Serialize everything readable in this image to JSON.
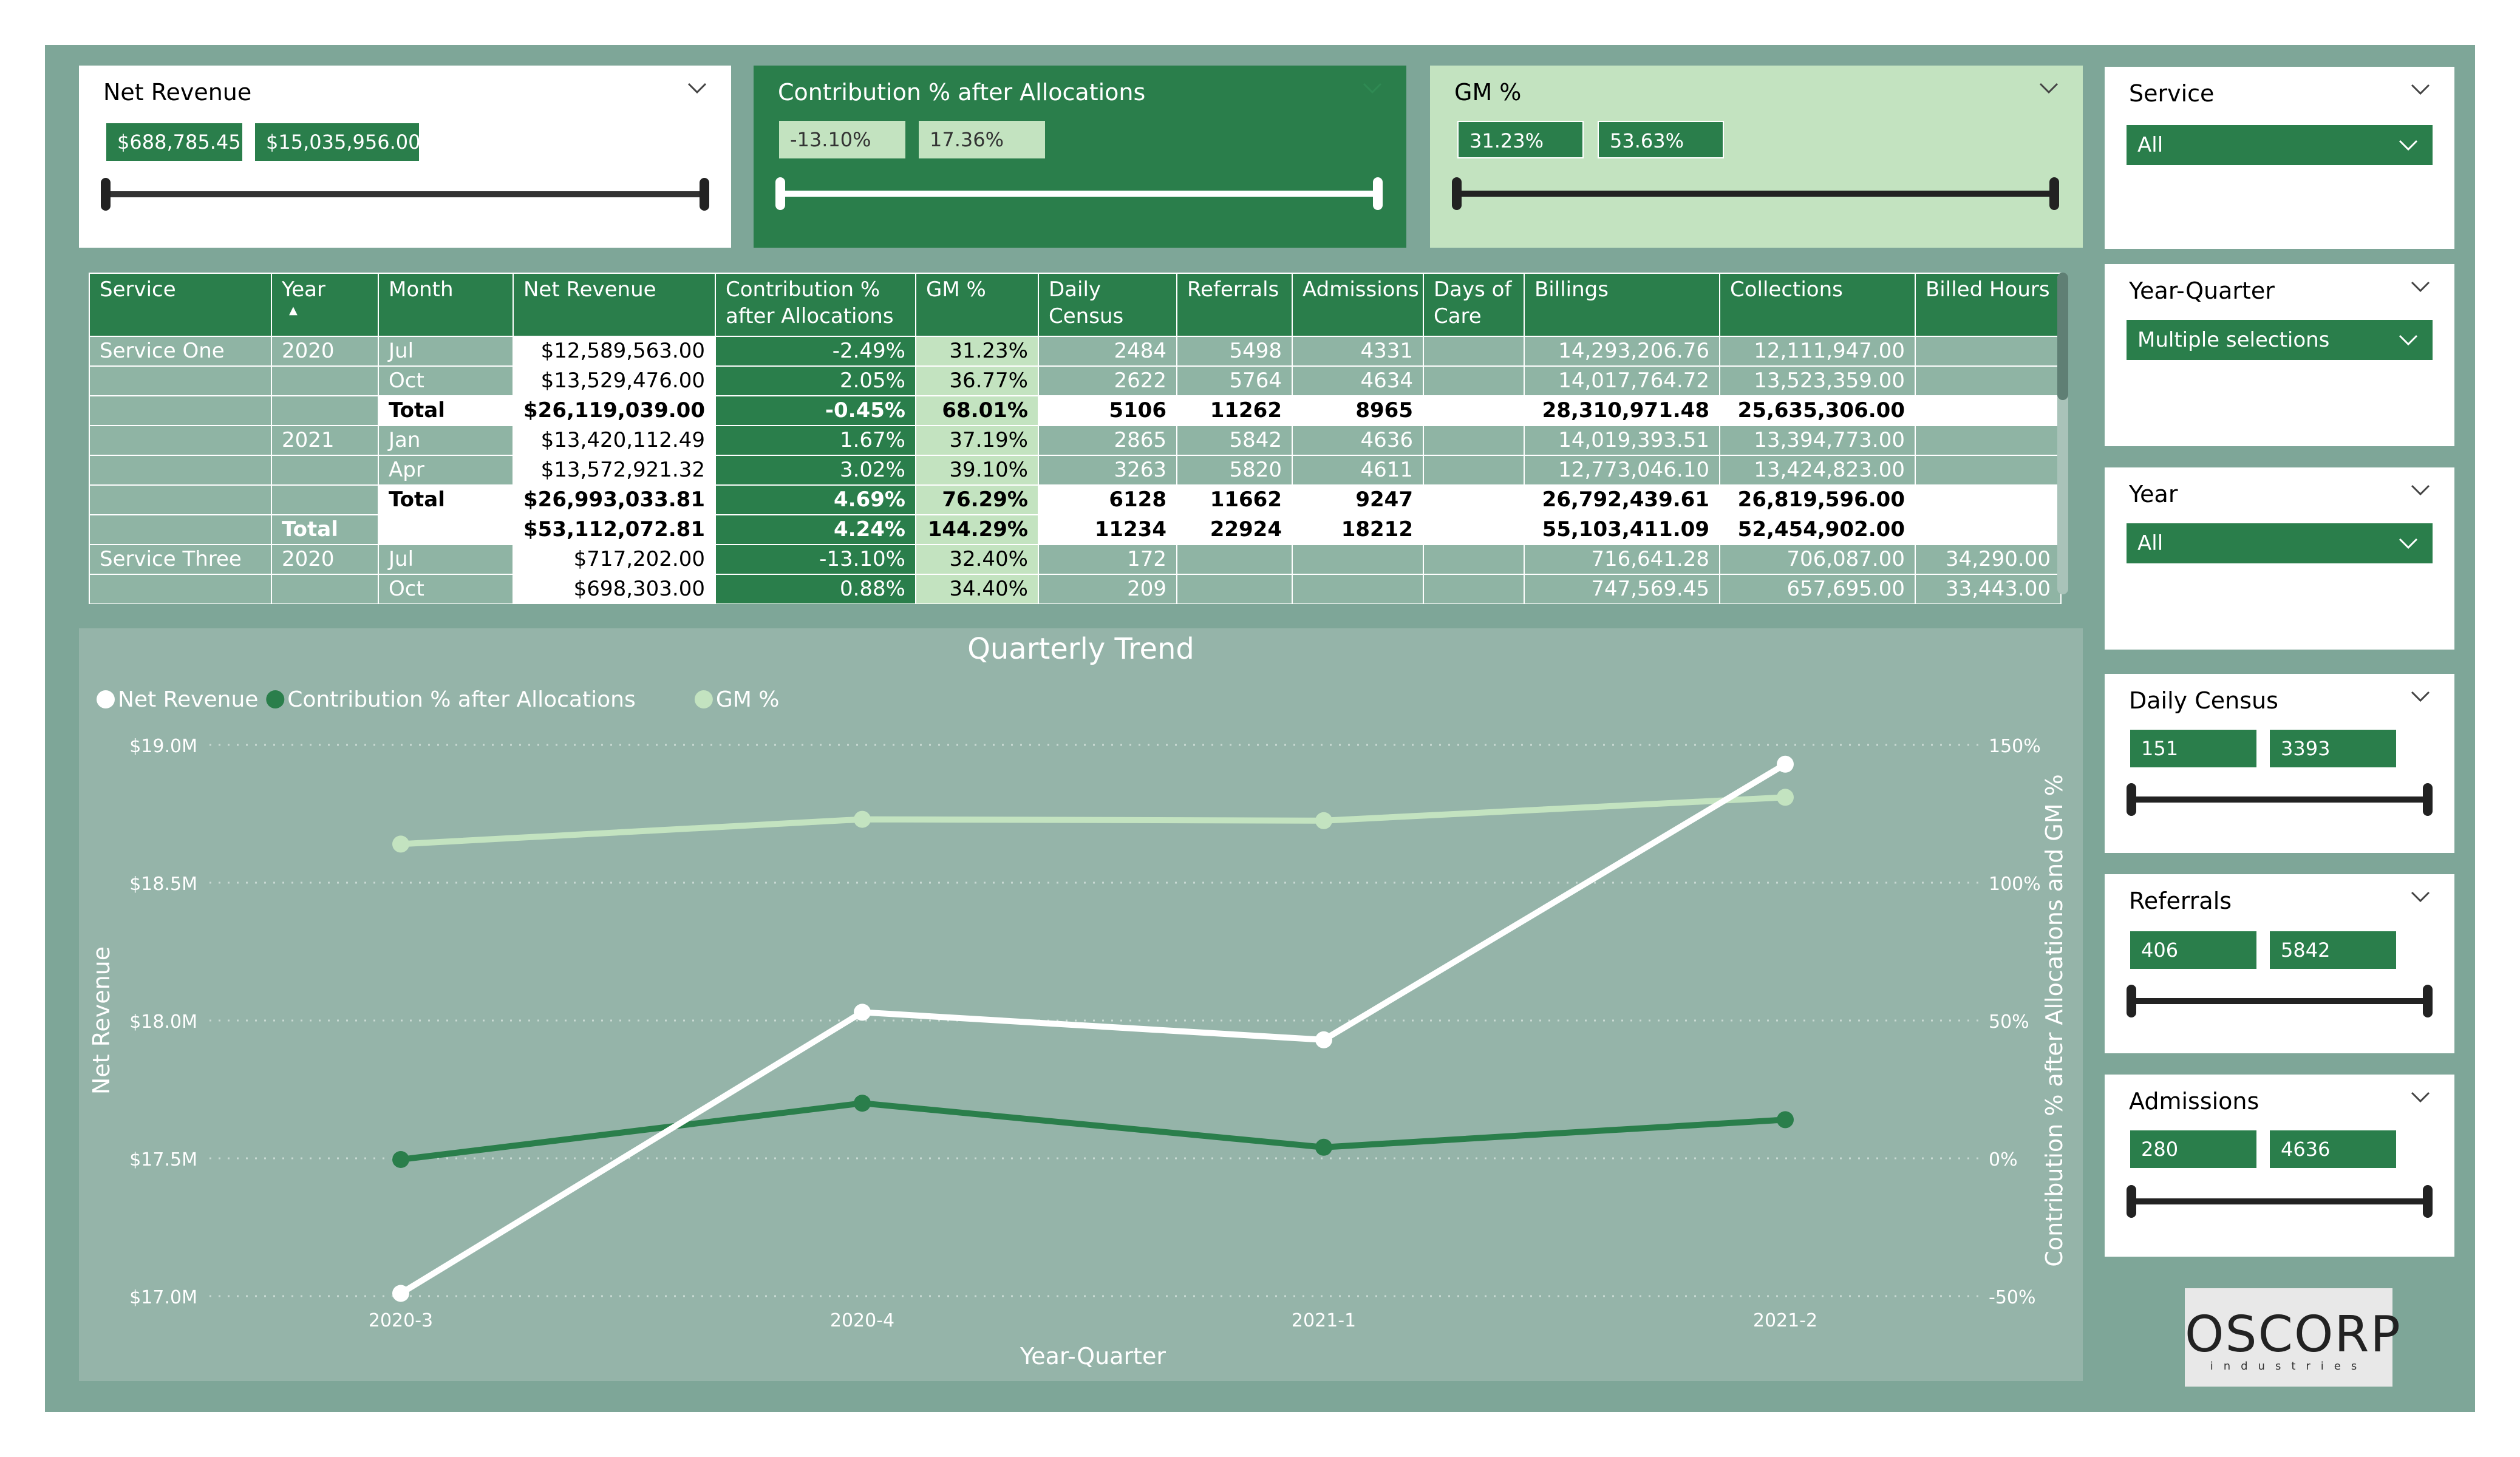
{
  "colors": {
    "dark_green": "#2a7e4b",
    "light_green": "#c3e3c0",
    "frame": "#7ea698",
    "chart_bg": "#95b4a9",
    "white": "#ffffff"
  },
  "top_slicers": {
    "net_revenue": {
      "title": "Net Revenue",
      "min": "$688,785.45",
      "max": "$15,035,956.00"
    },
    "contribution": {
      "title": "Contribution % after Allocations",
      "min": "-13.10%",
      "max": "17.36%"
    },
    "gm": {
      "title": "GM %",
      "min": "31.23%",
      "max": "53.63%"
    }
  },
  "right_slicers": {
    "service": {
      "title": "Service",
      "value": "All"
    },
    "year_quarter": {
      "title": "Year-Quarter",
      "value": "Multiple selections"
    },
    "year": {
      "title": "Year",
      "value": "All"
    },
    "daily_census": {
      "title": "Daily Census",
      "min": "151",
      "max": "3393"
    },
    "referrals": {
      "title": "Referrals",
      "min": "406",
      "max": "5842"
    },
    "admissions": {
      "title": "Admissions",
      "min": "280",
      "max": "4636"
    }
  },
  "table": {
    "headers": [
      "Service",
      "Year",
      "Month",
      "Net Revenue",
      "Contribution %\nafter Allocations",
      "GM %",
      "Daily\nCensus",
      "Referrals",
      "Admissions",
      "Days of\nCare",
      "Billings",
      "Collections",
      "Billed Hours"
    ],
    "sort_indicator": "▲",
    "rows": [
      {
        "service": "Service One",
        "year": "2020",
        "month": "Jul",
        "net_revenue": "$12,589,563.00",
        "contribution": "-2.49%",
        "gm": "31.23%",
        "daily_census": "2484",
        "referrals": "5498",
        "admissions": "4331",
        "days_of_care": "",
        "billings": "14,293,206.76",
        "collections": "12,111,947.00",
        "billed_hours": ""
      },
      {
        "service": "",
        "year": "",
        "month": "Oct",
        "net_revenue": "$13,529,476.00",
        "contribution": "2.05%",
        "gm": "36.77%",
        "daily_census": "2622",
        "referrals": "5764",
        "admissions": "4634",
        "days_of_care": "",
        "billings": "14,017,764.72",
        "collections": "13,523,359.00",
        "billed_hours": ""
      },
      {
        "service": "",
        "year": "",
        "month": "Total",
        "net_revenue": "$26,119,039.00",
        "contribution": "-0.45%",
        "gm": "68.01%",
        "daily_census": "5106",
        "referrals": "11262",
        "admissions": "8965",
        "days_of_care": "",
        "billings": "28,310,971.48",
        "collections": "25,635,306.00",
        "billed_hours": "",
        "total": true
      },
      {
        "service": "",
        "year": "2021",
        "month": "Jan",
        "net_revenue": "$13,420,112.49",
        "contribution": "1.67%",
        "gm": "37.19%",
        "daily_census": "2865",
        "referrals": "5842",
        "admissions": "4636",
        "days_of_care": "",
        "billings": "14,019,393.51",
        "collections": "13,394,773.00",
        "billed_hours": ""
      },
      {
        "service": "",
        "year": "",
        "month": "Apr",
        "net_revenue": "$13,572,921.32",
        "contribution": "3.02%",
        "gm": "39.10%",
        "daily_census": "3263",
        "referrals": "5820",
        "admissions": "4611",
        "days_of_care": "",
        "billings": "12,773,046.10",
        "collections": "13,424,823.00",
        "billed_hours": ""
      },
      {
        "service": "",
        "year": "",
        "month": "Total",
        "net_revenue": "$26,993,033.81",
        "contribution": "4.69%",
        "gm": "76.29%",
        "daily_census": "6128",
        "referrals": "11662",
        "admissions": "9247",
        "days_of_care": "",
        "billings": "26,792,439.61",
        "collections": "26,819,596.00",
        "billed_hours": "",
        "total": true
      },
      {
        "service": "",
        "year": "Total",
        "month": "",
        "net_revenue": "$53,112,072.81",
        "contribution": "4.24%",
        "gm": "144.29%",
        "daily_census": "11234",
        "referrals": "22924",
        "admissions": "18212",
        "days_of_care": "",
        "billings": "55,103,411.09",
        "collections": "52,454,902.00",
        "billed_hours": "",
        "total": true
      },
      {
        "service": "Service Three",
        "year": "2020",
        "month": "Jul",
        "net_revenue": "$717,202.00",
        "contribution": "-13.10%",
        "gm": "32.40%",
        "daily_census": "172",
        "referrals": "",
        "admissions": "",
        "days_of_care": "",
        "billings": "716,641.28",
        "collections": "706,087.00",
        "billed_hours": "34,290.00"
      },
      {
        "service": "",
        "year": "",
        "month": "Oct",
        "net_revenue": "$698,303.00",
        "contribution": "0.88%",
        "gm": "34.40%",
        "daily_census": "209",
        "referrals": "",
        "admissions": "",
        "days_of_care": "",
        "billings": "747,569.45",
        "collections": "657,695.00",
        "billed_hours": "33,443.00"
      }
    ]
  },
  "chart_data": {
    "type": "line",
    "title": "Quarterly Trend",
    "x": [
      "2020-3",
      "2020-4",
      "2021-1",
      "2021-2"
    ],
    "xlabel": "Year-Quarter",
    "ylabel": "Net Revenue",
    "y2label": "Contribution % after Allocations and GM %",
    "ylim": [
      17.0,
      19.0
    ],
    "y_ticks": [
      "$19.0M",
      "$18.5M",
      "$18.0M",
      "$17.5M",
      "$17.0M"
    ],
    "y2lim": [
      -50,
      150
    ],
    "y2_ticks": [
      "150%",
      "100%",
      "50%",
      "0%",
      "-50%"
    ],
    "legend": "top-left",
    "grid": true,
    "series": [
      {
        "name": "Net Revenue",
        "axis": "left",
        "unit": "$M",
        "color": "#ffffff",
        "values": [
          17.01,
          18.03,
          17.93,
          18.93
        ]
      },
      {
        "name": "Contribution % after Allocations",
        "axis": "right",
        "unit": "%",
        "color": "#2a7e4b",
        "values": [
          -0.45,
          20.0,
          4.0,
          14.0
        ]
      },
      {
        "name": "GM %",
        "axis": "right",
        "unit": "%",
        "color": "#c3e3c0",
        "values": [
          114.0,
          123.0,
          122.5,
          131.0
        ]
      }
    ]
  },
  "logo": {
    "name": "OSCORP",
    "sub": "industries"
  }
}
